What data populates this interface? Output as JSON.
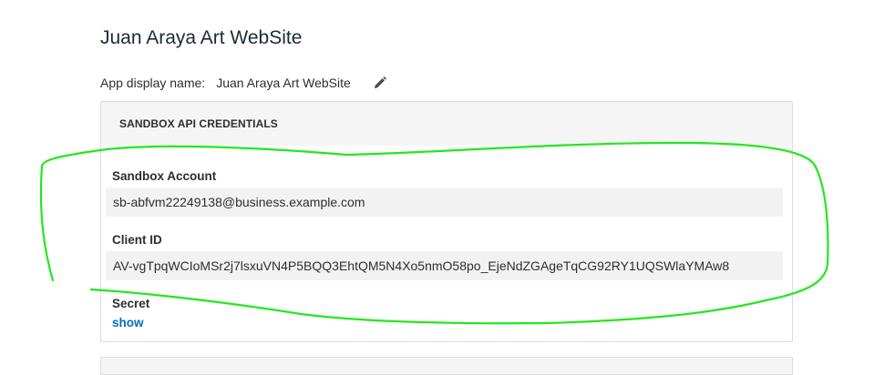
{
  "app": {
    "title": "Juan Araya Art WebSite",
    "display_name_label": "App display name:",
    "display_name_value": "Juan Araya Art WebSite",
    "edit_icon": "pencil-icon"
  },
  "credentials": {
    "header": "SANDBOX API CREDENTIALS",
    "fields": [
      {
        "label": "Sandbox Account",
        "value": "sb-abfvm22249138@business.example.com"
      },
      {
        "label": "Client ID",
        "value": "AV-vgTpqWCIoMSr2j7lsxuVN4P5BQQ3EhtQM5N4Xo5nmO58po_EjeNdZGAgeTqCG92RY1UQSWlaYMAw8"
      }
    ],
    "secret_label": "Secret",
    "secret_action": "show"
  },
  "colors": {
    "link": "#0070ba",
    "annotation": "#22e81e",
    "header_bg": "#f5f5f5",
    "field_bg": "#f2f2f2"
  }
}
